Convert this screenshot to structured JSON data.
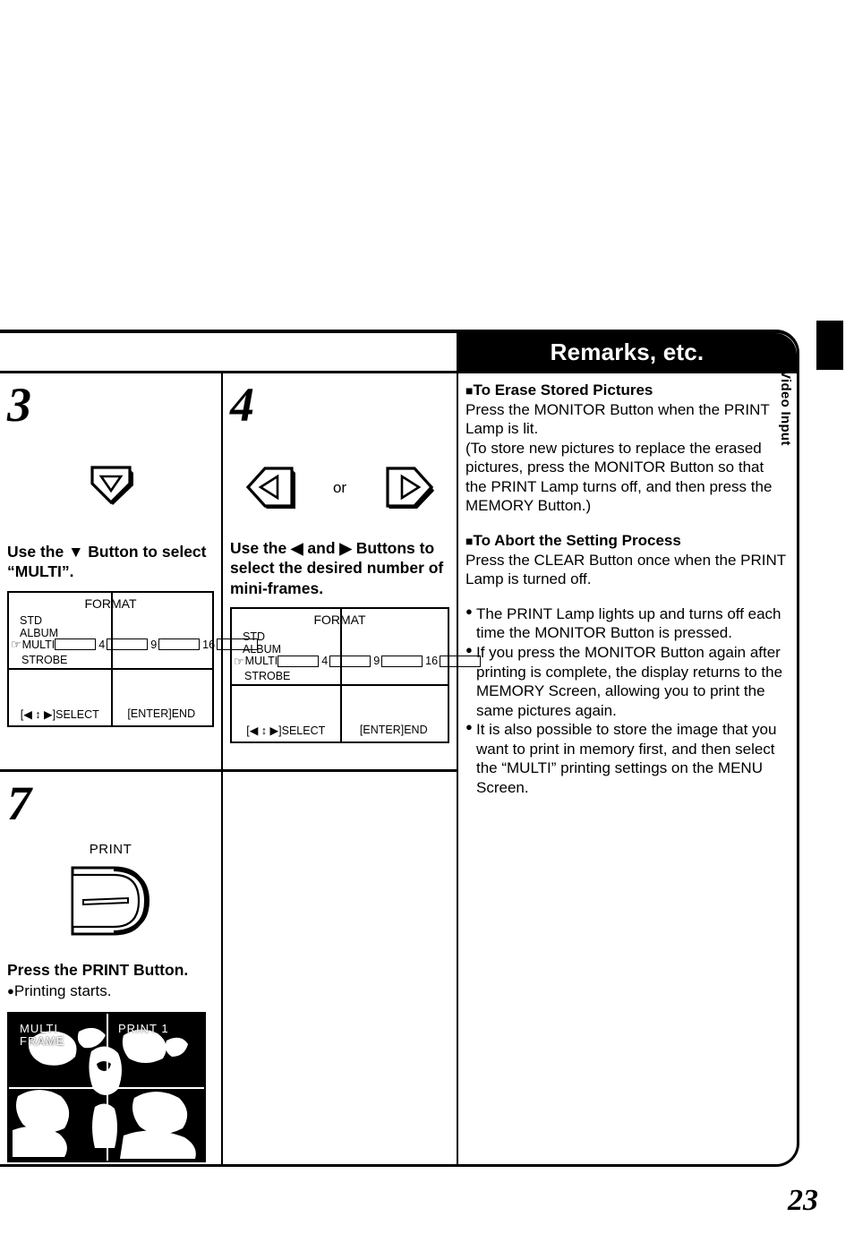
{
  "page": {
    "number": "23",
    "side_tab_label": "Video Input"
  },
  "remarks": {
    "header_title": "Remarks, etc.",
    "sections": [
      {
        "heading": "To Erase Stored Pictures",
        "paragraphs": [
          "Press the MONITOR Button when the PRINT Lamp is lit.",
          "(To store new pictures to replace the erased pictures, press the MONITOR Button so that the PRINT Lamp turns off, and then press the MEMORY Button.)"
        ]
      },
      {
        "heading": "To Abort the Setting Process",
        "paragraphs": [
          "Press the CLEAR Button once when the PRINT Lamp is turned off."
        ]
      }
    ],
    "bullets": [
      "The PRINT Lamp lights up and turns off each time the MONITOR Button is pressed.",
      "If you press the MONITOR Button again after printing is complete, the display returns to the MEMORY Screen, allowing you to print the same pictures again.",
      "It is also possible to store the image that you want to print in memory first, and then select the “MULTI” printing settings on the MENU Screen."
    ],
    "bullet_marker": "●",
    "heading_marker": "■"
  },
  "steps": [
    {
      "number": "3",
      "buttons": [
        {
          "icon": "down-arrow-button",
          "glyph": "▽"
        }
      ],
      "caption": "Use the ▼ Button to select “MULTI”.",
      "has_osd": true
    },
    {
      "number": "4",
      "buttons": [
        {
          "icon": "left-arrow-button",
          "glyph": "◁"
        },
        {
          "icon": "right-arrow-button",
          "glyph": "▷"
        }
      ],
      "or_label": "or",
      "caption": "Use the ◀ and ▶ Buttons to select the desired number of mini-frames.",
      "has_osd": true
    },
    {
      "number": "7",
      "print_label": "PRINT",
      "caption": "Press the PRINT Button.",
      "sub_bullet": "Printing starts.",
      "sub_bullet_marker": "●"
    }
  ],
  "osd": {
    "title": "FORMAT",
    "menu_items": [
      "STD",
      "ALBUM",
      "MULTI",
      "STROBE"
    ],
    "selected_item": "MULTI",
    "pointer_icon": "pointing-hand-icon",
    "pointer_glyph": "☞",
    "frame_counts": [
      "4",
      "9",
      "16"
    ],
    "footer_left": "[◀ ↕ ▶]SELECT",
    "footer_right": "[ENTER]END"
  },
  "photo": {
    "overlay_left": "MULTI\nFRAME",
    "overlay_left_line1": "MULTI",
    "overlay_left_line2": "FRAME",
    "overlay_right": "PRINT  1",
    "description": "multi-frame preview of a portrait split into four mini-frames"
  },
  "colors": {
    "ink": "#000000",
    "paper": "#ffffff"
  }
}
